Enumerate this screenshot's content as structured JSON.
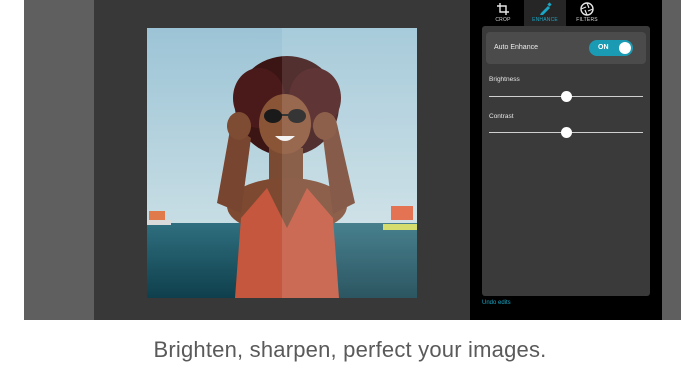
{
  "tabs": [
    {
      "label": "CROP",
      "icon": "crop-icon"
    },
    {
      "label": "ENHANCE",
      "icon": "pencil-icon",
      "active": true
    },
    {
      "label": "FILTERS",
      "icon": "aperture-icon"
    }
  ],
  "auto_enhance": {
    "label": "Auto Enhance",
    "state": "ON"
  },
  "sliders": [
    {
      "label": "Brightness",
      "level_percent": 50
    },
    {
      "label": "Contrast",
      "level_percent": 50
    }
  ],
  "undo_label": "Undo edits",
  "caption": "Brighten, sharpen, perfect your images.",
  "colors": {
    "accent": "#1aa6c4",
    "toggle": "#1a9bb3",
    "panel": "#3a3a3a",
    "frame": "#5f5f5f",
    "canvas": "#383838"
  }
}
